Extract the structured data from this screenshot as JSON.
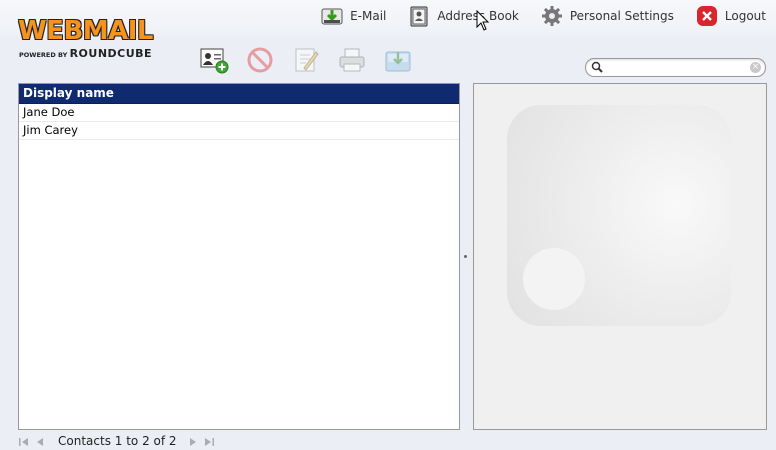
{
  "logo": {
    "main": "WEBMAIL",
    "powered": "POWERED BY",
    "brand": "ROUNDCUBE"
  },
  "nav": [
    {
      "label": "E-Mail",
      "icon": "email-icon"
    },
    {
      "label": "Address Book",
      "icon": "address-book-icon"
    },
    {
      "label": "Personal Settings",
      "icon": "gear-icon"
    },
    {
      "label": "Logout",
      "icon": "logout-icon"
    }
  ],
  "toolbar": [
    {
      "name": "add-contact",
      "icon": "add-contact-icon",
      "enabled": true
    },
    {
      "name": "delete",
      "icon": "delete-icon",
      "enabled": false
    },
    {
      "name": "edit",
      "icon": "edit-icon",
      "enabled": false
    },
    {
      "name": "print",
      "icon": "print-icon",
      "enabled": false
    },
    {
      "name": "import",
      "icon": "import-icon",
      "enabled": false
    }
  ],
  "search": {
    "value": "",
    "placeholder": ""
  },
  "contacts": {
    "header": "Display name",
    "rows": [
      "Jane Doe",
      "Jim Carey"
    ]
  },
  "pager": {
    "count_text": "Contacts 1 to 2 of 2"
  },
  "colors": {
    "header_bg": "#0f2a6e",
    "logo_orange": "#f6921e",
    "page_bg": "#ebeff5"
  }
}
